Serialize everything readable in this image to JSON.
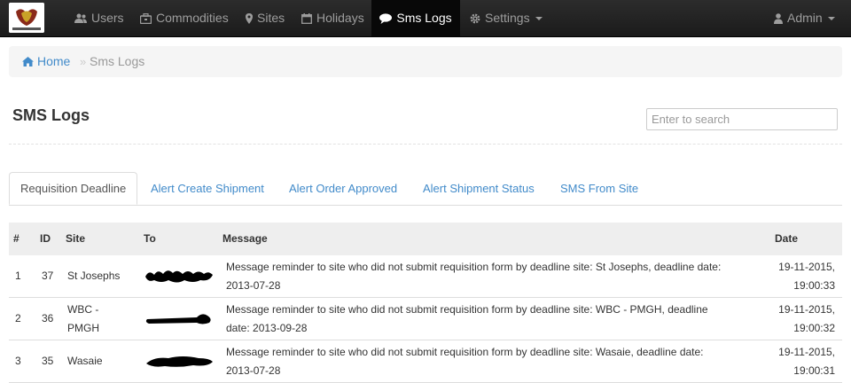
{
  "navbar": {
    "logo_text": "DEPARTMENT OF HEALTH",
    "items": [
      {
        "label": "Users",
        "icon": "users-icon"
      },
      {
        "label": "Commodities",
        "icon": "briefcase-icon"
      },
      {
        "label": "Sites",
        "icon": "map-marker-icon"
      },
      {
        "label": "Holidays",
        "icon": "calendar-icon"
      },
      {
        "label": "Sms Logs",
        "icon": "comment-icon",
        "active": true
      },
      {
        "label": "Settings",
        "icon": "gear-icon",
        "dropdown": true
      }
    ],
    "user": {
      "label": "Admin",
      "icon": "user-icon",
      "dropdown": true
    }
  },
  "breadcrumb": {
    "home": "Home",
    "separator": "»",
    "current": "Sms Logs"
  },
  "page": {
    "title": "SMS Logs",
    "search_placeholder": "Enter to search"
  },
  "tabs": [
    {
      "label": "Requisition Deadline",
      "active": true
    },
    {
      "label": "Alert Create Shipment"
    },
    {
      "label": "Alert Order Approved"
    },
    {
      "label": "Alert Shipment Status"
    },
    {
      "label": "SMS From Site"
    }
  ],
  "table": {
    "columns": [
      "#",
      "ID",
      "Site",
      "To",
      "Message",
      "Date"
    ],
    "rows": [
      {
        "index": "1",
        "id": "37",
        "site": "St Josephs",
        "message": "Message reminder to site who did not submit requisition form by deadline site: St Josephs, deadline date: 2013-07-28",
        "date": "19-11-2015,",
        "time": "19:00:33"
      },
      {
        "index": "2",
        "id": "36",
        "site": "WBC - PMGH",
        "message": "Message reminder to site who did not submit requisition form by deadline site: WBC - PMGH, deadline date: 2013-09-28",
        "date": "19-11-2015,",
        "time": "19:00:32"
      },
      {
        "index": "3",
        "id": "35",
        "site": "Wasaie",
        "message": "Message reminder to site who did not submit requisition form by deadline site: Wasaie, deadline date: 2013-07-28",
        "date": "19-11-2015,",
        "time": "19:00:31"
      }
    ]
  },
  "colors": {
    "navbar_bg": "#222222",
    "link": "#428bca",
    "header_bg": "#eeeeee",
    "breadcrumb_bg": "#f5f5f5"
  }
}
